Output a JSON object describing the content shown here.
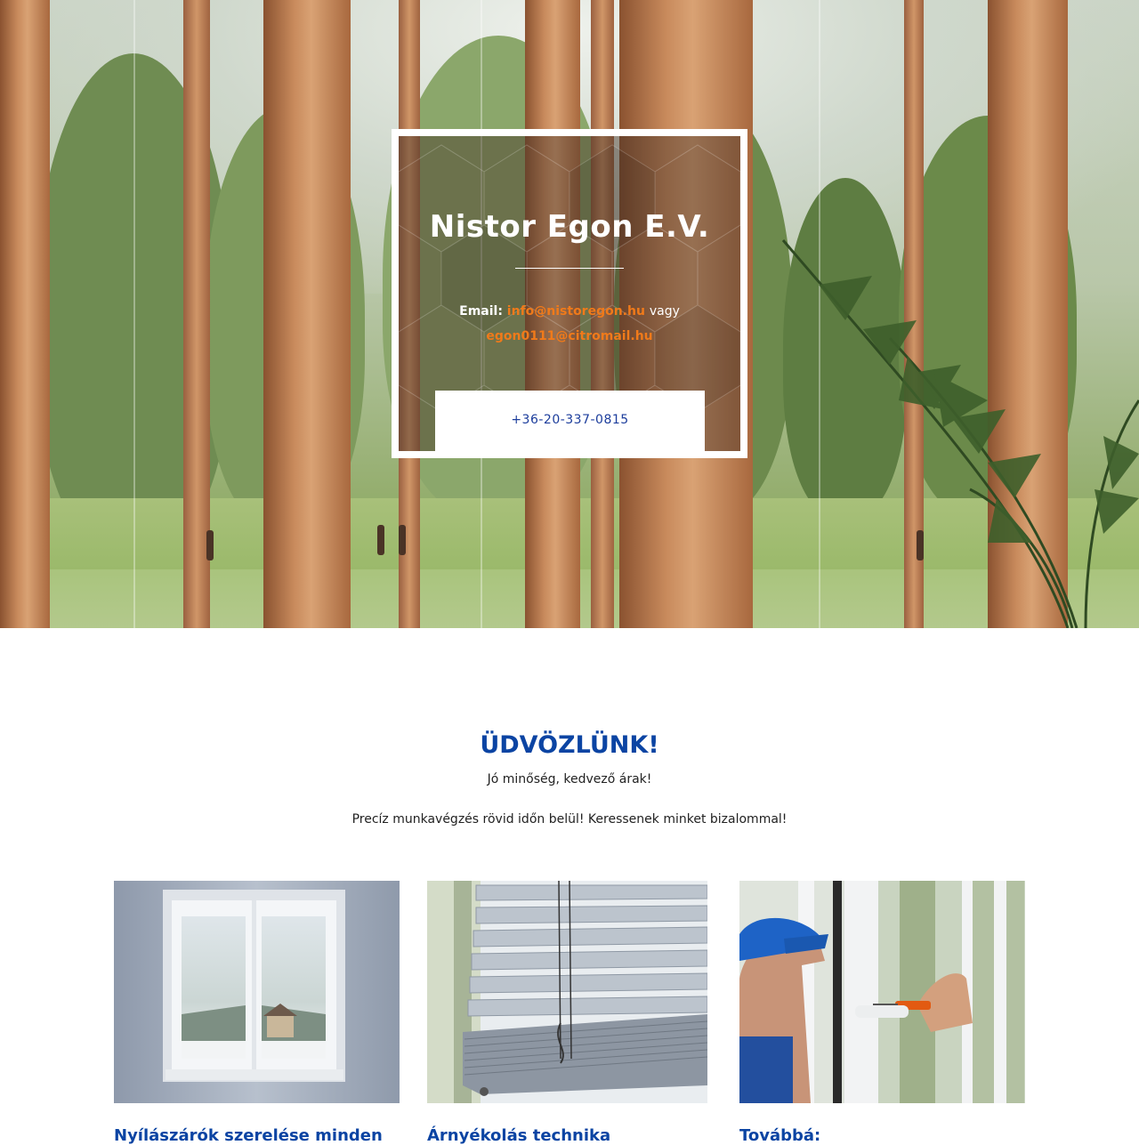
{
  "hero": {
    "company_name": "Nistor Egon E.V.",
    "email_label": "Email:",
    "email_primary": "info@nistoregon.hu",
    "email_separator": "vagy",
    "email_secondary": "egon0111@citromail.hu",
    "phone_button": "+36-20-337-0815"
  },
  "welcome": {
    "title": "ÜDVÖZLÜNK!",
    "subtitle": "Jó minőség, kedvező árak!",
    "text": "Precíz munkavégzés rövid időn belül! Keressenek minket bizalommal!"
  },
  "services": [
    {
      "title": "Nyílászárók szerelése minden",
      "image": "window-winter-view"
    },
    {
      "title": "Árnyékolás technika",
      "image": "window-blinds"
    },
    {
      "title": "Továbbá:",
      "image": "repairman-screwdriver-window"
    }
  ],
  "colors": {
    "accent_blue": "#0b44a3",
    "link_orange": "#f07a1a",
    "phone_blue": "#1c3d9c"
  }
}
